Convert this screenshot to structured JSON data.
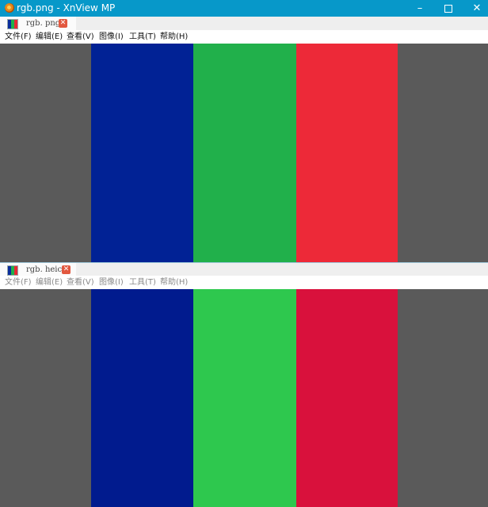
{
  "window": {
    "title": "rgb.png - XnView MP",
    "icon": "xnview-app-icon",
    "controls": {
      "minimize": "–",
      "maximize": "□",
      "close": "✕"
    }
  },
  "top_pane": {
    "tab": {
      "label": "rgb. png",
      "icon": "rgb-image-thumbnail-icon",
      "close_icon": "close-tab-icon"
    },
    "menu": [
      "文件(F)",
      "编辑(E)",
      "查看(V)",
      "图像(I)",
      "工具(T)",
      "帮助(H)"
    ],
    "stripe_colors": {
      "background": "#5a5a5a",
      "blue": "#012295",
      "green": "#21b04b",
      "red": "#ed2938"
    }
  },
  "bottom_pane": {
    "tab": {
      "label": "rgb. heic",
      "icon": "rgb-image-thumbnail-icon",
      "close_icon": "close-tab-icon"
    },
    "menu": [
      "文件(F)",
      "编辑(E)",
      "查看(V)",
      "图像(I)",
      "工具(T)",
      "帮助(H)"
    ],
    "menu_state": "inactive",
    "stripe_colors": {
      "background": "#5a5a5a",
      "blue": "#011b8e",
      "green": "#2ec84e",
      "red": "#d9113c"
    }
  }
}
